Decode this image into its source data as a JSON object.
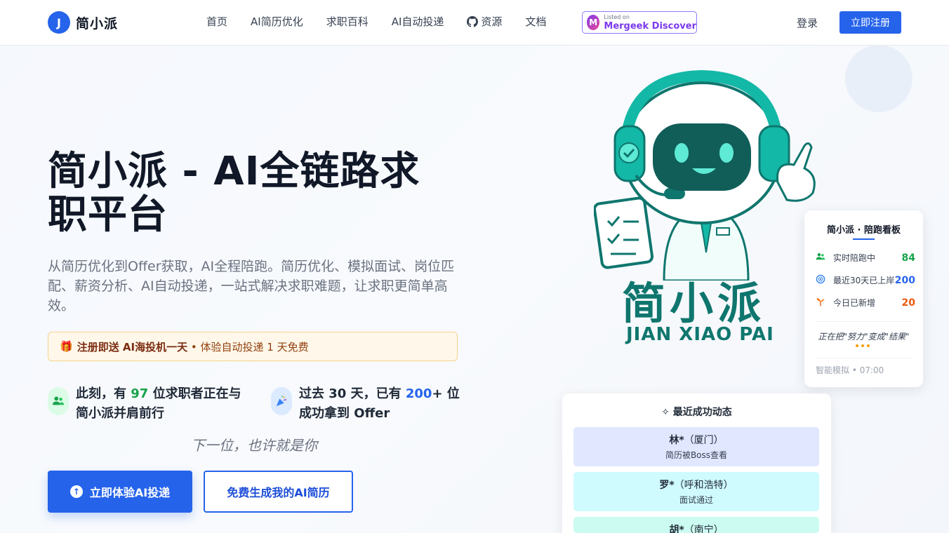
{
  "header": {
    "logo_letter": "J",
    "logo_text": "简小派",
    "nav": [
      {
        "label": "首页"
      },
      {
        "label": "AI简历优化"
      },
      {
        "label": "求职百科"
      },
      {
        "label": "AI自动投递"
      },
      {
        "label": "资源",
        "icon": "github-icon"
      },
      {
        "label": "文档"
      }
    ],
    "badge": {
      "small": "Listed on",
      "big": "Mergeek Discover"
    },
    "login": "登录",
    "register": "立即注册"
  },
  "hero": {
    "title": "简小派 - AI全链路求职平台",
    "subtitle": "从简历优化到Offer获取，AI全程陪跑。简历优化、模拟面试、岗位匹配、薪资分析、AI自动投递，一站式解决求职难题，让求职更简单高效。",
    "promo": {
      "strong": "注册即送 AI海投机一天",
      "rest": " • 体验自动投递 1 天免费"
    },
    "stat1": {
      "pre": "此刻，有 ",
      "num": "97",
      "post": " 位求职者正在与简小派并肩前行"
    },
    "stat2": {
      "pre": "过去 30 天，已有 ",
      "num": "200",
      "post": "+ 位成功拿到 Offer"
    },
    "tagline": "下一位，也许就是你",
    "btn_primary": "立即体验AI投递",
    "btn_outline": "免费生成我的AI简历"
  },
  "brand": {
    "cn": "简小派",
    "en": "JIAN XIAO PAI"
  },
  "dashboard": {
    "title": "简小派 · 陪跑看板",
    "rows": [
      {
        "label": "实时陪跑中",
        "value": "84",
        "icon": "users-icon"
      },
      {
        "label": "最近30天已上岸",
        "value": "200",
        "icon": "target-icon"
      },
      {
        "label": "今日已新增",
        "value": "20",
        "icon": "sprout-icon"
      }
    ],
    "quote": "正在把\"努力\"变成\"结果\"",
    "footer": "智能模拟 • 07:00"
  },
  "recent": {
    "title": "最近成功动态",
    "items": [
      {
        "name": "林*",
        "city": "（厦门）",
        "desc": "简历被Boss查看",
        "color": "#e0e7ff"
      },
      {
        "name": "罗*",
        "city": "（呼和浩特）",
        "desc": "面试通过",
        "color": "#cffafe"
      },
      {
        "name": "胡*",
        "city": "（南宁）",
        "desc": "",
        "color": "#ccfbf1"
      }
    ]
  },
  "colors": {
    "primary": "#2563eb",
    "brand_teal": "#0f766e",
    "success": "#16a34a",
    "accent_orange": "#ea580c"
  }
}
